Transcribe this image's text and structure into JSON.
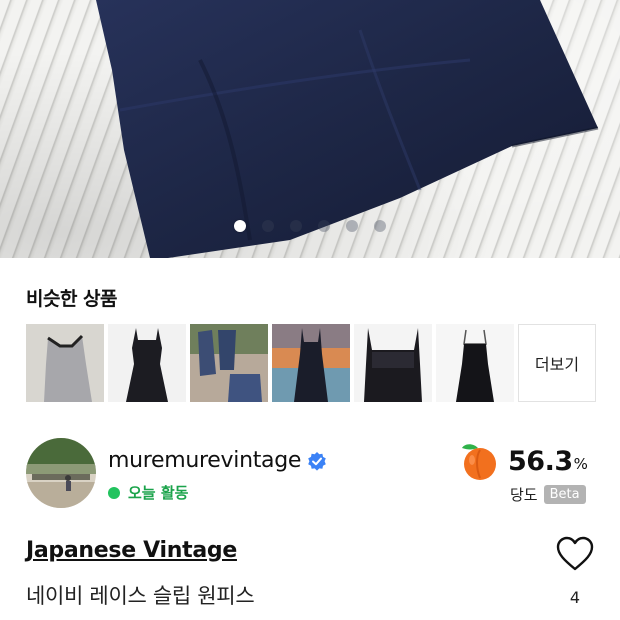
{
  "carousel": {
    "page_count": 6,
    "active_index": 0
  },
  "similar": {
    "title": "비슷한 상품",
    "thumbnails": [
      {
        "icon": "gray-slip-dress-thumbnail"
      },
      {
        "icon": "black-sleeveless-dress-thumbnail"
      },
      {
        "icon": "denim-clothes-thumbnail"
      },
      {
        "icon": "beach-dress-thumbnail"
      },
      {
        "icon": "black-lace-dress-thumbnail"
      },
      {
        "icon": "black-slip-dress-thumbnail"
      }
    ],
    "more_label": "더보기"
  },
  "seller": {
    "name": "muremurevintage",
    "activity": "오늘 활동",
    "activity_color": "#22c35e",
    "verified_color": "#3b82f6"
  },
  "score": {
    "value": "56.3",
    "unit": "%",
    "label": "당도",
    "badge": "Beta",
    "icon": "peach-icon"
  },
  "product": {
    "brand": "Japanese Vintage",
    "name": "네이비 레이스 슬립 원피스",
    "like_count": "4"
  },
  "colors": {
    "dress": "#1f2846",
    "text": "#111111"
  }
}
